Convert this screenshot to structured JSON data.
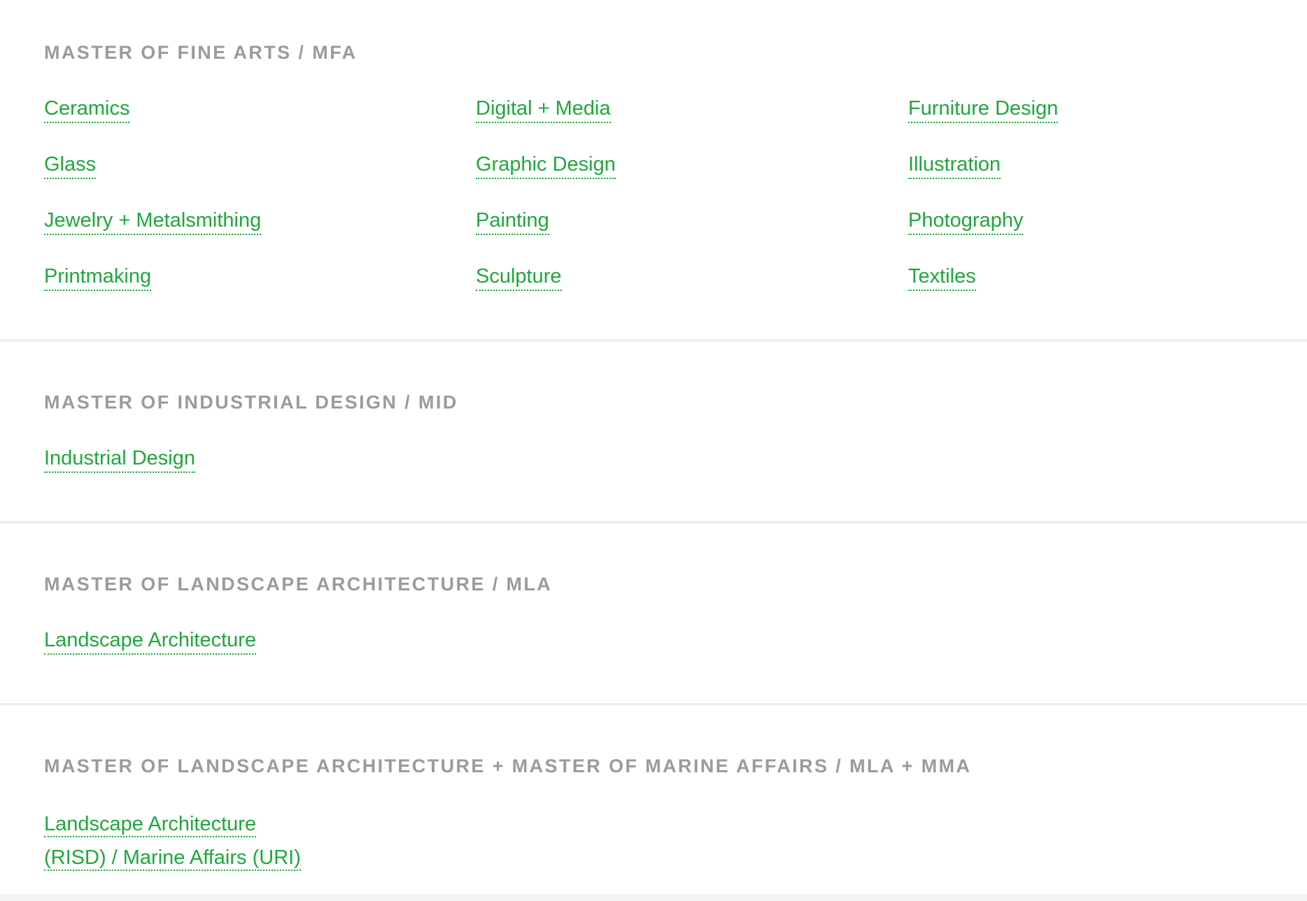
{
  "sections": [
    {
      "title": "MASTER OF FINE ARTS / MFA",
      "links": [
        "Ceramics",
        "Digital + Media",
        "Furniture Design",
        "Glass",
        "Graphic Design",
        "Illustration",
        "Jewelry + Metalsmithing",
        "Painting",
        "Photography",
        "Printmaking",
        "Sculpture",
        "Textiles"
      ]
    },
    {
      "title": "MASTER OF INDUSTRIAL DESIGN / MID",
      "links": [
        "Industrial Design"
      ]
    },
    {
      "title": "MASTER OF LANDSCAPE ARCHITECTURE / MLA",
      "links": [
        "Landscape Architecture"
      ]
    },
    {
      "title": "MASTER OF LANDSCAPE ARCHITECTURE + MASTER OF MARINE AFFAIRS / MLA + MMA",
      "links": [
        "Landscape Architecture",
        "(RISD) / Marine Affairs (URI)"
      ]
    }
  ],
  "colors": {
    "heading": "#9b9b9b",
    "link": "#1ea83c",
    "divider": "#ececec",
    "background": "#ffffff"
  }
}
